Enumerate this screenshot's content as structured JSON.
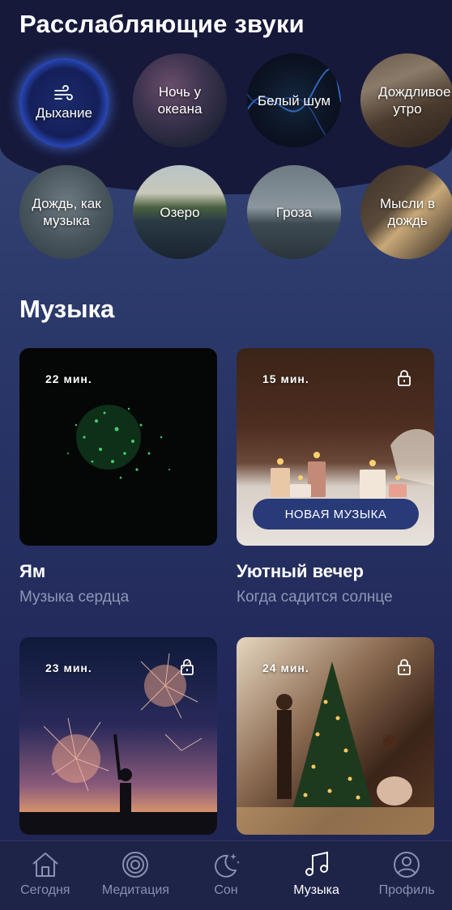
{
  "sections": {
    "sounds_title": "Расслабляющие звуки",
    "music_title": "Музыка"
  },
  "sounds": [
    {
      "label": "Дыхание",
      "icon": "wind-icon"
    },
    {
      "label": "Ночь у океана"
    },
    {
      "label": "Белый шум"
    },
    {
      "label": "Дождливое утро"
    },
    {
      "label": "Дождь, как музыка"
    },
    {
      "label": "Озеро"
    },
    {
      "label": "Гроза"
    },
    {
      "label": "Мысли в дождь"
    }
  ],
  "music": [
    {
      "duration": "22 мин.",
      "title": "Ям",
      "subtitle": "Музыка сердца",
      "locked": false
    },
    {
      "duration": "15 мин.",
      "title": "Уютный вечер",
      "subtitle": "Когда садится солнце",
      "locked": true,
      "badge": "НОВАЯ МУЗЫКА"
    },
    {
      "duration": "23 мин.",
      "locked": true
    },
    {
      "duration": "24 мин.",
      "locked": true
    }
  ],
  "tabs": [
    {
      "label": "Сегодня",
      "icon": "home-icon"
    },
    {
      "label": "Медитация",
      "icon": "meditation-icon"
    },
    {
      "label": "Сон",
      "icon": "moon-icon"
    },
    {
      "label": "Музыка",
      "icon": "music-note-icon",
      "active": true
    },
    {
      "label": "Профиль",
      "icon": "profile-icon"
    }
  ],
  "colors": {
    "background": "#202a55",
    "header_background": "#16193a",
    "tabbar_background": "#1e2348",
    "badge_background": "#283a78",
    "subtitle_text": "#8f97b6",
    "tab_inactive": "#8a91b0"
  }
}
